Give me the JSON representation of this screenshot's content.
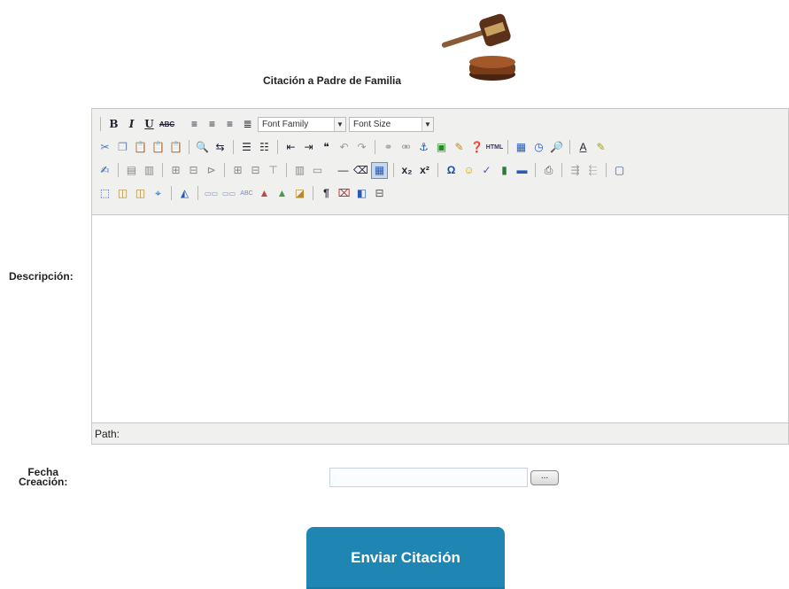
{
  "header": {
    "title": "Citación a Padre de Familia",
    "logo_icon": "gavel-icon"
  },
  "form": {
    "descripcion_label": "Descripción:",
    "fecha_label_line1": "Fecha",
    "fecha_label_line2": "Creación:",
    "fecha_value": "",
    "fecha_button": "...",
    "submit_label": "Enviar Citación"
  },
  "editor": {
    "font_family": "Font Family",
    "font_size": "Font Size",
    "path_label": "Path:",
    "toolbar_row1": [
      "B",
      "I",
      "U",
      "ABC"
    ],
    "accent_colors": {
      "toolbar_bg": "#f0f0ee",
      "button_blue": "#1f86b4"
    }
  }
}
